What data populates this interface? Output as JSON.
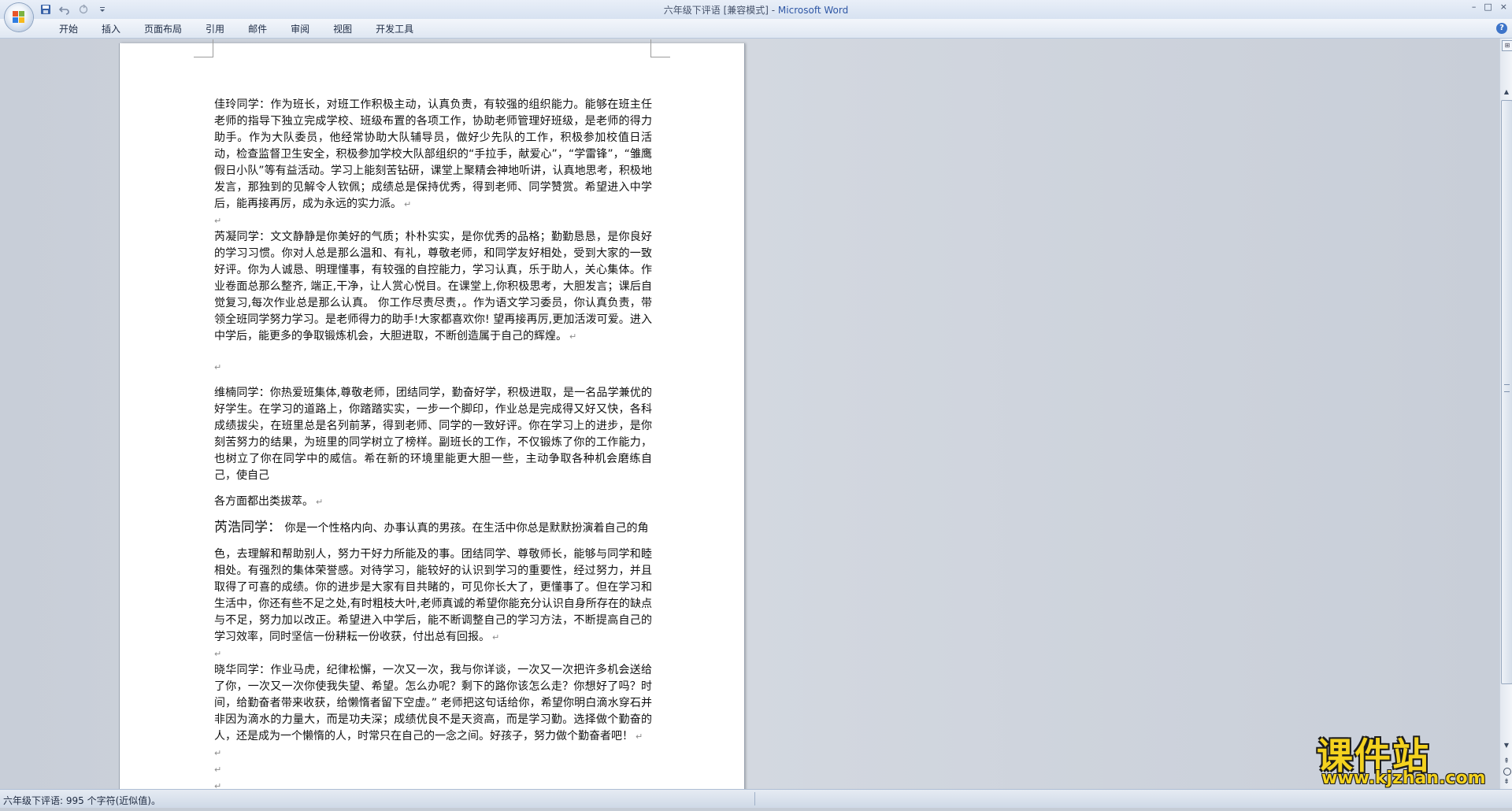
{
  "window": {
    "title": "六年级下评语 [兼容模式] - ",
    "app_name": "Microsoft Word",
    "controls": [
      "–",
      "□",
      "×"
    ]
  },
  "quick_access": {
    "save_icon": "save-icon",
    "undo_icon": "undo-icon",
    "redo_icon": "redo-icon",
    "customize_icon": "customize-qat-icon"
  },
  "ribbon": {
    "tabs": [
      "开始",
      "插入",
      "页面布局",
      "引用",
      "邮件",
      "审阅",
      "视图",
      "开发工具"
    ],
    "help": "?"
  },
  "document": {
    "paragraphs": [
      "佳玲同学：作为班长，对班工作积极主动，认真负责，有较强的组织能力。能够在班主任老师的指导下独立完成学校、班级布置的各项工作，协助老师管理好班级，是老师的得力助手。作为大队委员，他经常协助大队辅导员，做好少先队的工作，积极参加校值日活动，检查监督卫生安全，积极参加学校大队部组织的“手拉手，献爱心”，“学雷锋”，“雏鹰假日小队”等有益活动。学习上能刻苦钻研，课堂上聚精会神地听讲，认真地思考，积极地发言，那独到的见解令人钦佩；成绩总是保持优秀，得到老师、同学赞赏。希望进入中学后，能再接再厉，成为永远的实力派。",
      "芮凝同学：文文静静是你美好的气质；朴朴实实，是你优秀的品格；勤勤恳恳，是你良好的学习习惯。你对人总是那么温和、有礼，尊敬老师，和同学友好相处，受到大家的一致好评。你为人诚恳、明理懂事，有较强的自控能力，学习认真，乐于助人，关心集体。作业卷面总那么整齐, 端正,干净，让人赏心悦目。在课堂上,你积极思考，大胆发言；课后自觉复习,每次作业总是那么认真。 你工作尽责尽责，。作为语文学习委员，你认真负责，带领全班同学努力学习。是老师得力的助手!大家都喜欢你! 望再接再厉,更加活泼可爱。进入中学后，能更多的争取锻炼机会，大胆进取，不断创造属于自己的辉煌。",
      "维楠同学：你热爱班集体,尊敬老师，团结同学，勤奋好学，积极进取，是一名品学兼优的好学生。在学习的道路上，你踏踏实实，一步一个脚印，作业总是完成得又好又快，各科成绩拔尖，在班里总是名列前茅，得到老师、同学的一致好评。你在学习上的进步，是你刻苦努力的结果，为班里的同学树立了榜样。副班长的工作，不仅锻炼了你的工作能力，也树立了你在同学中的威信。希在新的环境里能更大胆一些，主动争取各种机会磨练自己，使自己",
      "各方面都出类拔萃。",
      "你是一个性格内向、办事认真的男孩。在生活中你总是默默扮演着自己的角",
      "色，去理解和帮助别人，努力干好力所能及的事。团结同学、尊敬师长，能够与同学和睦相处。有强烈的集体荣誉感。对待学习，能较好的认识到学习的重要性，经过努力，并且取得了可喜的成绩。你的进步是大家有目共睹的，可见你长大了，更懂事了。但在学习和生活中，你还有些不足之处,有时粗枝大叶,老师真诚的希望你能充分认识自身所存在的缺点与不足，努力加以改正。希望进入中学后，能不断调整自己的学习方法，不断提高自己的学习效率，同时坚信一份耕耘一份收获，付出总有回报。",
      "晓华同学：作业马虎，纪律松懈，一次又一次，我与你详谈，一次又一次把许多机会送给了你，一次又一次你使我失望、希望。怎么办呢？剩下的路你该怎么走？你想好了吗？时间，给勤奋者带来收获，给懒惰者留下空虚。” 老师把这句话给你，希望你明白滴水穿石并非因为滴水的力量大，而是功夫深；成绩优良不是天资高，而是学习勤。选择做个勤奋的人，还是成为一个懒惰的人，时常只在自己的一念之间。好孩子，努力做个勤奋者吧！"
    ],
    "name_prefix": "芮浩同学：",
    "para_mark": "↵"
  },
  "statusbar": {
    "text": "六年级下评语: 995 个字符(近似值)。"
  },
  "watermark": {
    "main": "课件站",
    "url": "www.kjzhan.com"
  },
  "scrollbar": {
    "up": "▲",
    "down": "▼",
    "prev": "⇞",
    "next": "⇟"
  }
}
